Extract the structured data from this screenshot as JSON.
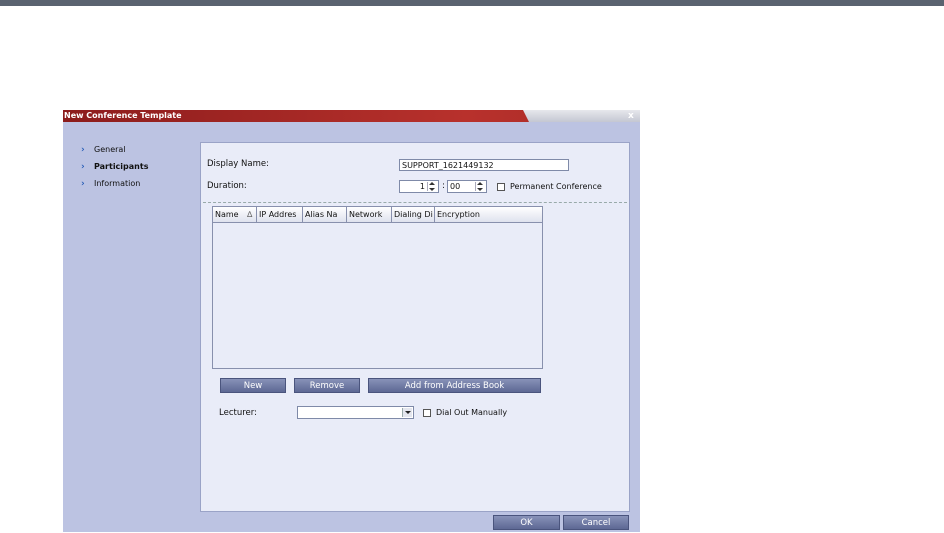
{
  "dialog": {
    "title": "New Conference Template",
    "close_glyph": "x"
  },
  "nav": {
    "items": [
      {
        "label": "General",
        "icon": "chevron-right-icon"
      },
      {
        "label": "Participants",
        "icon": "chevron-right-icon",
        "active": true
      },
      {
        "label": "Information",
        "icon": "chevron-right-icon"
      }
    ]
  },
  "form": {
    "display_name_label": "Display Name:",
    "display_name_value": "SUPPORT_1621449132",
    "duration_label": "Duration:",
    "duration_hours": "1",
    "duration_separator": ":",
    "duration_minutes": "00",
    "permanent_label": "Permanent Conference",
    "permanent_checked": false
  },
  "participants_table": {
    "columns": [
      "Name",
      "IP Addres",
      "Alias Na",
      "Network",
      "Dialing Di",
      "Encryption"
    ],
    "sort_indicator": "∆",
    "rows": []
  },
  "actions": {
    "new_label": "New",
    "remove_label": "Remove",
    "add_from_book_label": "Add from Address Book"
  },
  "lecturer": {
    "label": "Lecturer:",
    "value": "",
    "dial_out_label": "Dial Out Manually",
    "dial_out_checked": false
  },
  "footer": {
    "ok_label": "OK",
    "cancel_label": "Cancel"
  },
  "colors": {
    "title_bar": "#a82a27",
    "dialog_bg": "#bcc3e2",
    "panel_bg": "#e9ecf8",
    "button": "#6b76a0",
    "chevron": "#2a5fb8"
  }
}
